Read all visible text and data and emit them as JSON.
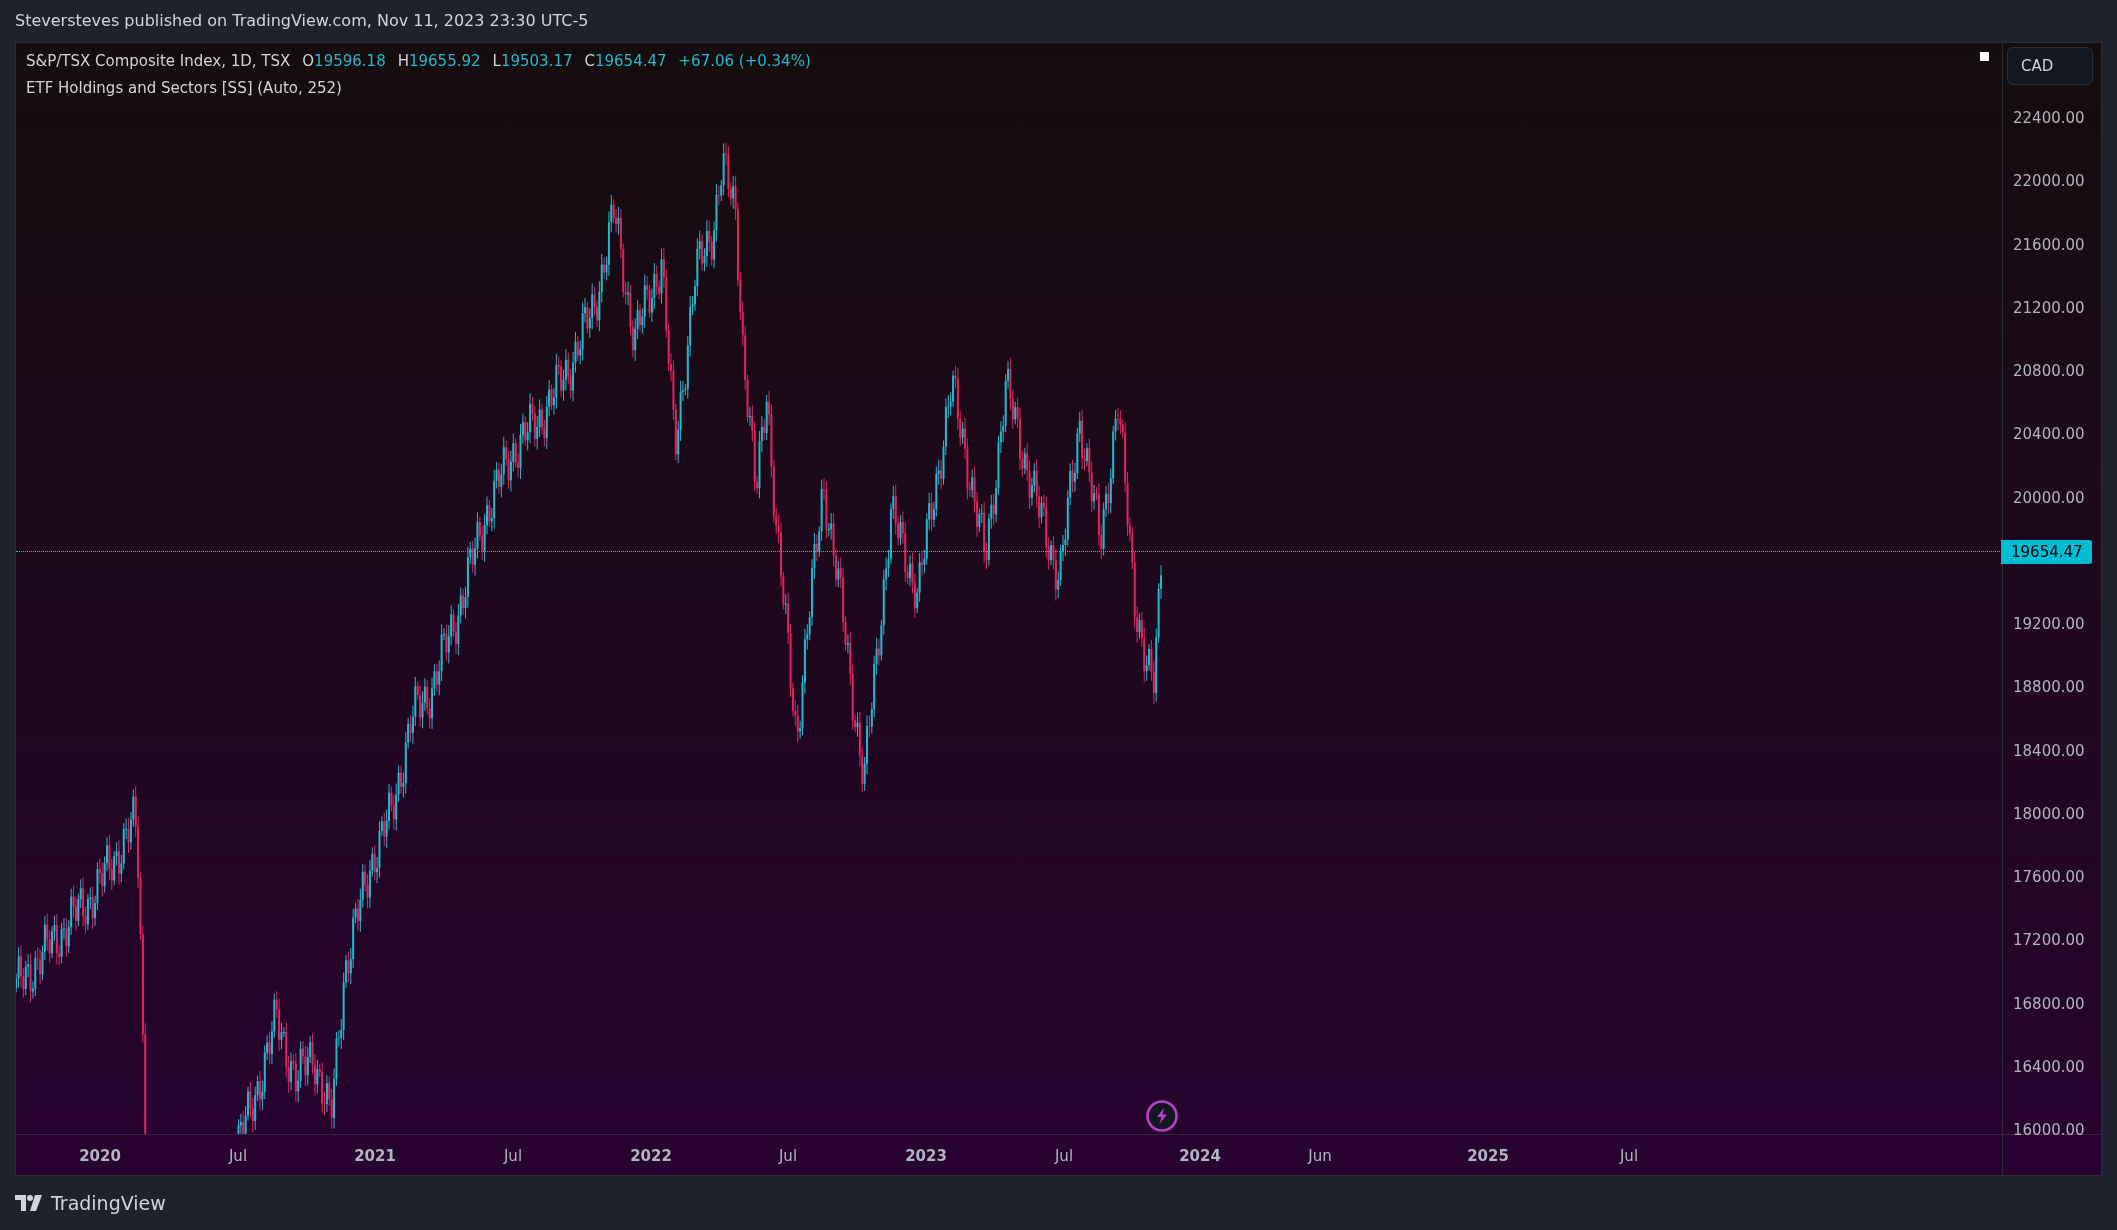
{
  "header": {
    "text": "Steversteves published on TradingView.com, Nov 11, 2023 23:30 UTC-5"
  },
  "legend": {
    "symbol": "S&P/TSX Composite Index, 1D, TSX",
    "values": [
      {
        "label": "O",
        "value": "19596.18"
      },
      {
        "label": "H",
        "value": "19655.92"
      },
      {
        "label": "L",
        "value": "19503.17"
      },
      {
        "label": "C",
        "value": "19654.47"
      }
    ],
    "change": "+67.06 (+0.34%)",
    "indicator": "ETF Holdings and Sectors [SS] (Auto, 252)"
  },
  "currency_button": "CAD",
  "price_axis": {
    "labels": [
      "22400.00",
      "22000.00",
      "21600.00",
      "21200.00",
      "20800.00",
      "20400.00",
      "20000.00",
      "19200.00",
      "18800.00",
      "18400.00",
      "18000.00",
      "17600.00",
      "17200.00",
      "16800.00",
      "16400.00",
      "16000.00"
    ],
    "last_price": "19654.47"
  },
  "time_axis": {
    "labels": [
      {
        "text": "2020",
        "kind": "year"
      },
      {
        "text": "Jul",
        "kind": "month"
      },
      {
        "text": "2021",
        "kind": "year"
      },
      {
        "text": "Jul",
        "kind": "month"
      },
      {
        "text": "2022",
        "kind": "year"
      },
      {
        "text": "Jul",
        "kind": "month"
      },
      {
        "text": "2023",
        "kind": "year"
      },
      {
        "text": "Jul",
        "kind": "month"
      },
      {
        "text": "2024",
        "kind": "year"
      },
      {
        "text": "Jun",
        "kind": "month"
      },
      {
        "text": "2025",
        "kind": "year"
      },
      {
        "text": "Jul",
        "kind": "month"
      }
    ]
  },
  "footer": {
    "brand": "TradingView"
  }
}
